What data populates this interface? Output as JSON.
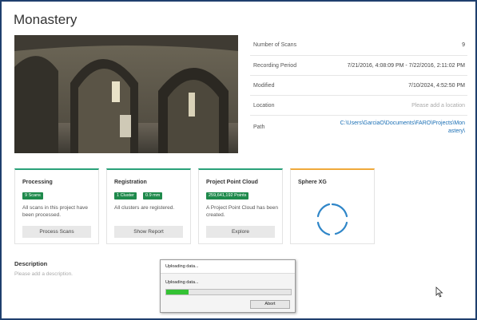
{
  "page": {
    "title": "Monastery"
  },
  "info": [
    {
      "label": "Number of Scans",
      "value": "9"
    },
    {
      "label": "Recording Period",
      "value": "7/21/2016, 4:08:09 PM - 7/22/2016, 2:11:02 PM"
    },
    {
      "label": "Modified",
      "value": "7/10/2024, 4:52:50 PM"
    },
    {
      "label": "Location",
      "value": "Please add a location"
    },
    {
      "label": "Path",
      "value": "C:\\Users\\GarciaO\\Documents\\FARO\\Projects\\Monastery\\"
    }
  ],
  "cards": [
    {
      "title": "Processing",
      "badges": [
        "9 Scans"
      ],
      "desc": "All scans in this project have been processed.",
      "button": "Process Scans"
    },
    {
      "title": "Registration",
      "badges": [
        "1 Cluster",
        "0.9 mm"
      ],
      "desc": "All clusters are registered.",
      "button": "Show Report"
    },
    {
      "title": "Project Point Cloud",
      "badges": [
        "259,641,192 Points"
      ],
      "desc": "A Project Point Cloud has been created.",
      "button": "Explore"
    },
    {
      "title": "Sphere XG"
    }
  ],
  "description": {
    "title": "Description",
    "placeholder": "Please add a description."
  },
  "dialog": {
    "title": "Uploading data...",
    "message": "Uploading data...",
    "progress": 0.18,
    "abort": "Abort"
  },
  "colors": {
    "accent_green": "#2aa179",
    "accent_orange": "#f0a93b",
    "badge_green": "#1f8a4c",
    "link_blue": "#1a6fb5",
    "progress_green": "#34c234"
  }
}
